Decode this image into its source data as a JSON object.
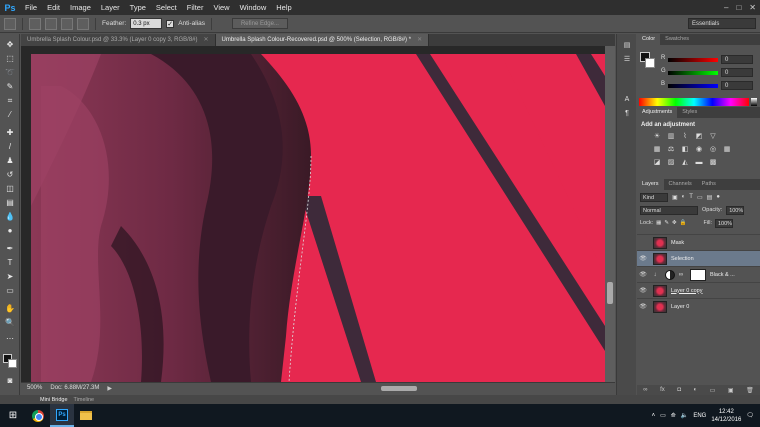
{
  "app": {
    "logo": "Ps",
    "menu": [
      "File",
      "Edit",
      "Image",
      "Layer",
      "Type",
      "Select",
      "Filter",
      "View",
      "Window",
      "Help"
    ],
    "window_controls": [
      "–",
      "□",
      "✕"
    ]
  },
  "options_bar": {
    "feather_label": "Feather:",
    "feather_value": "0.3 px",
    "antialias_label": "Anti-alias",
    "refine_edge_label": "Refine Edge...",
    "workspace": "Essentials"
  },
  "doc_tabs": [
    {
      "label": "Umbrella Splash Colour.psd @ 33.3% (Layer 0 copy 3, RGB/8#)",
      "active": false
    },
    {
      "label": "Umbrella Splash Colour-Recovered.psd @ 500% (Selection, RGB/8#) *",
      "active": true
    }
  ],
  "status": {
    "zoom": "500%",
    "doc": "Doc: 6.88M/27.3M"
  },
  "bottom_tabs": [
    "Mini Bridge",
    "Timeline"
  ],
  "color_panel": {
    "tabs": [
      "Color",
      "Swatches"
    ],
    "r_label": "R",
    "r_value": "0",
    "g_label": "G",
    "g_value": "0",
    "b_label": "B",
    "b_value": "0"
  },
  "adjustments_panel": {
    "tabs": [
      "Adjustments",
      "Styles"
    ],
    "title": "Add an adjustment"
  },
  "layers_panel": {
    "tabs": [
      "Layers",
      "Channels",
      "Paths"
    ],
    "kind": "Kind",
    "blend_mode": "Normal",
    "opacity_label": "Opacity:",
    "opacity_value": "100%",
    "lock_label": "Lock:",
    "fill_label": "Fill:",
    "fill_value": "100%",
    "layers": [
      {
        "name": "Mask",
        "visible": false,
        "selected": false,
        "type": "pixel"
      },
      {
        "name": "Selection",
        "visible": true,
        "selected": true,
        "type": "pixel"
      },
      {
        "name": "Black & ...",
        "visible": true,
        "selected": false,
        "type": "adjustment"
      },
      {
        "name": "Layer 0 copy",
        "visible": true,
        "selected": false,
        "type": "pixel",
        "underlined": true
      },
      {
        "name": "Layer 0",
        "visible": true,
        "selected": false,
        "type": "pixel"
      }
    ]
  },
  "taskbar": {
    "lang": "ENG",
    "time": "12:42",
    "date": "14/12/2016"
  },
  "colors": {
    "accent": "#31a8ff",
    "canvas_red": "#e8264e",
    "fabric": "#7a2e48"
  }
}
